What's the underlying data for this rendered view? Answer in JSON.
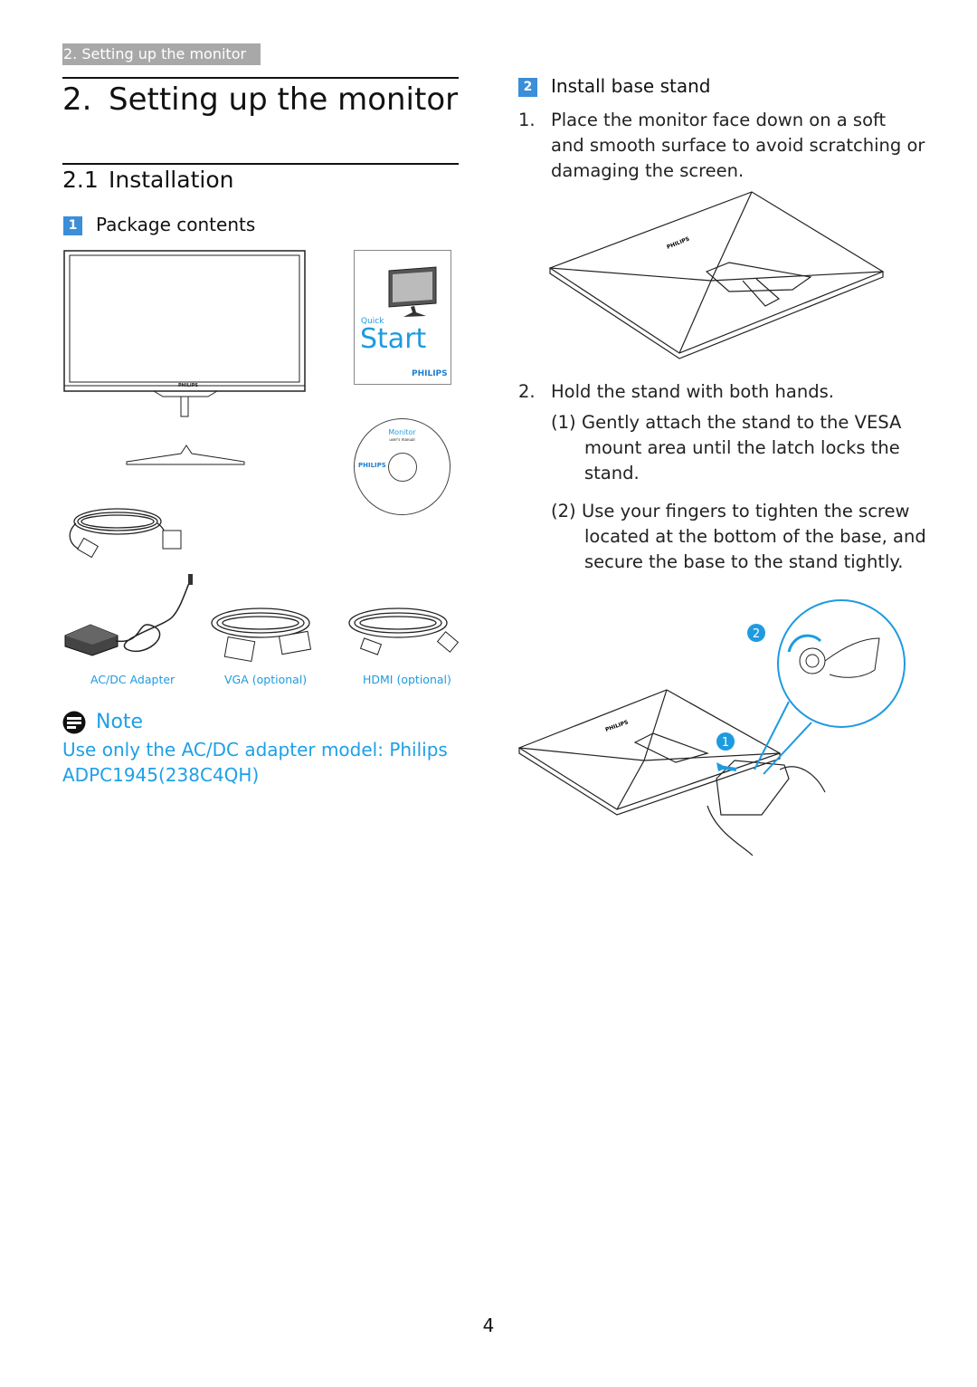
{
  "running_header": "2. Setting up the monitor",
  "chapter": {
    "number": "2.",
    "title": "Setting up the monitor"
  },
  "section": {
    "number": "2.1",
    "title": "Installation"
  },
  "package": {
    "badge": "1",
    "title": "Package contents",
    "quick_start": {
      "small": "Quick",
      "large": "Start",
      "brand": "PHILIPS"
    },
    "cd": {
      "title": "Monitor",
      "subtitle": "user's manual",
      "brand": "PHILIPS"
    },
    "monitor_brand": "PHILIPS",
    "captions": [
      "AC/DC Adapter",
      "VGA (optional)",
      "HDMI (optional)"
    ]
  },
  "note": {
    "title": "Note",
    "text_line1": "Use only the AC/DC adapter model: Philips",
    "text_line2": "ADPC1945(238C4QH)"
  },
  "install": {
    "badge": "2",
    "title": "Install base stand",
    "step1": {
      "num": "1.",
      "lines": [
        "Place the monitor face down on a soft",
        "and smooth surface to avoid scratching or",
        "damaging the screen."
      ]
    },
    "step2": {
      "num": "2.",
      "text": "Hold the stand with both hands."
    },
    "sub1": {
      "num": "(1)",
      "lines": [
        "Gently attach the stand to the VESA",
        "mount area until the latch locks the",
        "stand."
      ]
    },
    "sub2": {
      "num": "(2)",
      "lines": [
        "Use your fingers to tighten the screw",
        "located at the bottom of the base, and",
        "secure the base to the stand tightly."
      ]
    },
    "callouts": [
      "1",
      "2"
    ],
    "monitor_brand": "PHILIPS"
  },
  "page_number": "4",
  "colors": {
    "accent_blue": "#1e9be0",
    "badge_blue": "#3b8ed8",
    "header_gray": "#a8a8a8"
  }
}
